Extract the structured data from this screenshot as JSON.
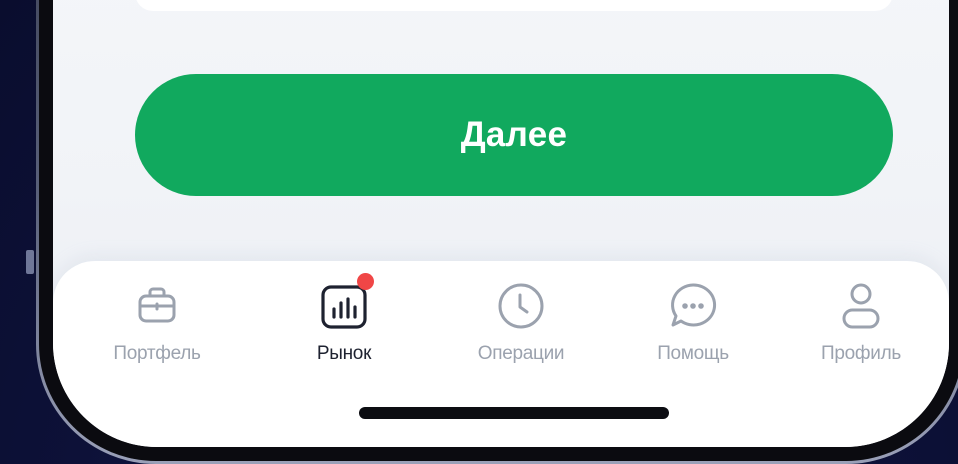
{
  "screen": {
    "primary_button_label": "Далее"
  },
  "tab_bar": {
    "tabs": [
      {
        "id": "portfolio",
        "label": "Портфель",
        "icon": "briefcase-icon",
        "active": false
      },
      {
        "id": "market",
        "label": "Рынок",
        "icon": "bar-chart-icon",
        "active": true,
        "badge": true
      },
      {
        "id": "operations",
        "label": "Операции",
        "icon": "clock-icon",
        "active": false
      },
      {
        "id": "help",
        "label": "Помощь",
        "icon": "chat-bubble-icon",
        "active": false
      },
      {
        "id": "profile",
        "label": "Профиль",
        "icon": "user-icon",
        "active": false
      }
    ]
  },
  "colors": {
    "accent_green": "#11a95e",
    "badge_red": "#f04646",
    "active_tab": "#1e2230",
    "inactive_tab": "#9ba2ae",
    "background": "#0d1138"
  }
}
